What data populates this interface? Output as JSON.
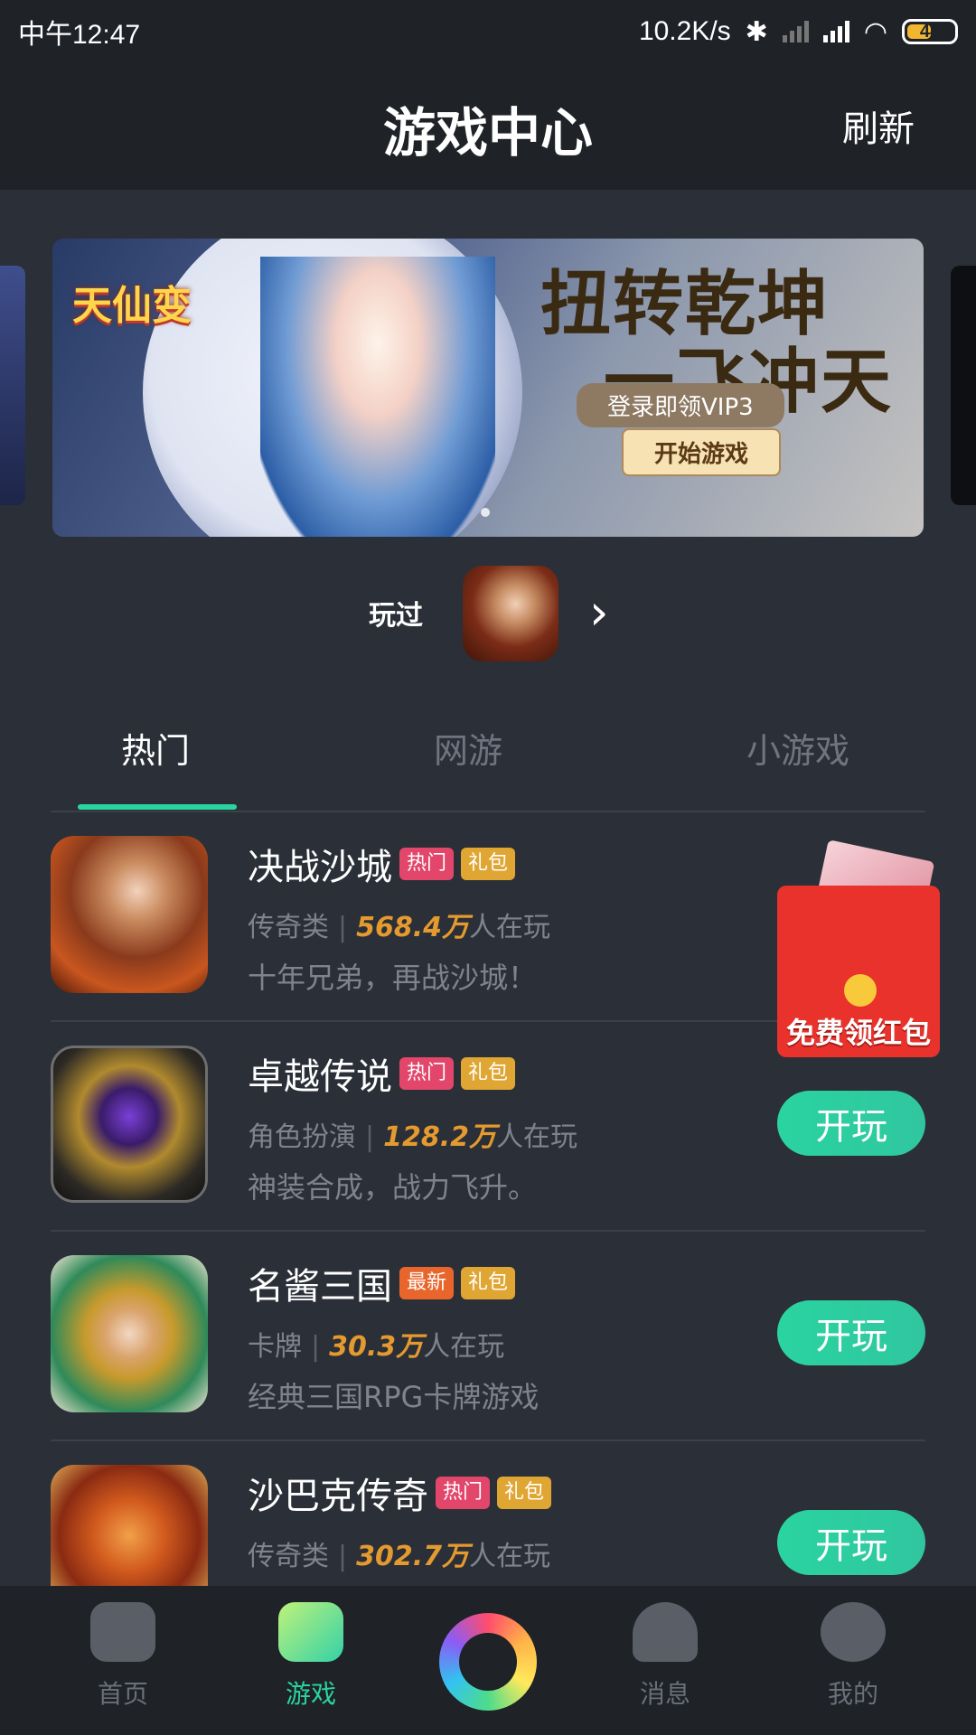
{
  "status_bar": {
    "time": "中午12:47",
    "network_speed": "10.2K/s",
    "battery": "44"
  },
  "header": {
    "title": "游戏中心",
    "refresh_label": "刷新"
  },
  "played": {
    "label": "玩过"
  },
  "tabs": [
    {
      "label": "热门",
      "active": true
    },
    {
      "label": "网游",
      "active": false
    },
    {
      "label": "小游戏",
      "active": false
    }
  ],
  "games": [
    {
      "name": "决战沙城",
      "badges": [
        "热门",
        "礼包"
      ],
      "category": "传奇类",
      "count": "568.4万",
      "suffix": "人在玩",
      "desc": "十年兄弟，再战沙城！"
    },
    {
      "name": "卓越传说",
      "badges": [
        "热门",
        "礼包"
      ],
      "category": "角色扮演",
      "count": "128.2万",
      "suffix": "人在玩",
      "desc": "神装合成，战力飞升。",
      "play": "开玩"
    },
    {
      "name": "名酱三国",
      "badges": [
        "最新",
        "礼包"
      ],
      "category": "卡牌",
      "count": "30.3万",
      "suffix": "人在玩",
      "desc": "经典三国RPG卡牌游戏",
      "play": "开玩"
    },
    {
      "name": "沙巴克传奇",
      "badges": [
        "热门",
        "礼包"
      ],
      "category": "传奇类",
      "count": "302.7万",
      "suffix": "人在玩",
      "desc": "",
      "play": "开玩"
    }
  ],
  "red_packet": {
    "label": "免费领红包"
  },
  "banner": {
    "logo": "天仙变",
    "headline_1": "扭转乾坤",
    "headline_2": "一飞冲天",
    "tag_1": "登录即领VIP3",
    "tag_2": "开始游戏"
  },
  "nav": [
    {
      "label": "首页"
    },
    {
      "label": "游戏",
      "active": true
    },
    {
      "label": "消息"
    },
    {
      "label": "我的"
    }
  ],
  "colors": {
    "accent": "#2ad4a0",
    "background": "#2b2f37",
    "count_highlight": "#e49a2f",
    "badge_hot": "#e2466b",
    "badge_gift": "#e0a634",
    "badge_new": "#e8662c"
  }
}
